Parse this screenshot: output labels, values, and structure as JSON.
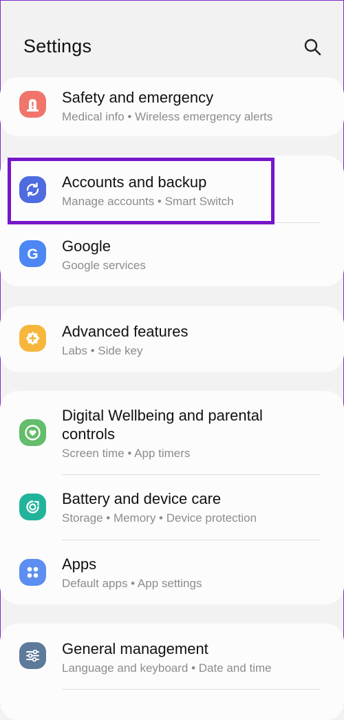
{
  "header": {
    "title": "Settings",
    "search_icon": "search-icon"
  },
  "items": {
    "safety": {
      "label": "Safety and emergency",
      "sub": "Medical info  •  Wireless emergency alerts",
      "icon": "safety-alert-icon",
      "color": "#f0766c"
    },
    "accounts": {
      "label": "Accounts and backup",
      "sub": "Manage accounts  •  Smart Switch",
      "icon": "sync-icon",
      "color": "#4f6be0"
    },
    "google": {
      "label": "Google",
      "sub": "Google services",
      "icon": "google-icon",
      "color": "#4c87f3"
    },
    "advanced": {
      "label": "Advanced features",
      "sub": "Labs  •  Side key",
      "icon": "puzzle-plus-icon",
      "color": "#f7b63c"
    },
    "wellbeing": {
      "label_line1": "Digital Wellbeing and parental",
      "label_line2": "controls",
      "sub": "Screen time  •  App timers",
      "icon": "wellbeing-heart-icon",
      "color": "#63bd6b"
    },
    "battery": {
      "label": "Battery and device care",
      "sub": "Storage  •  Memory  •  Device protection",
      "icon": "device-care-icon",
      "color": "#22b39b"
    },
    "apps": {
      "label": "Apps",
      "sub": "Default apps  •  App settings",
      "icon": "apps-grid-icon",
      "color": "#5b8ef0"
    },
    "general": {
      "label": "General management",
      "sub": "Language and keyboard  •  Date and time",
      "icon": "sliders-icon",
      "color": "#5d7a9b"
    }
  },
  "highlight": {
    "color": "#7716c9",
    "target": "Accounts and backup"
  }
}
